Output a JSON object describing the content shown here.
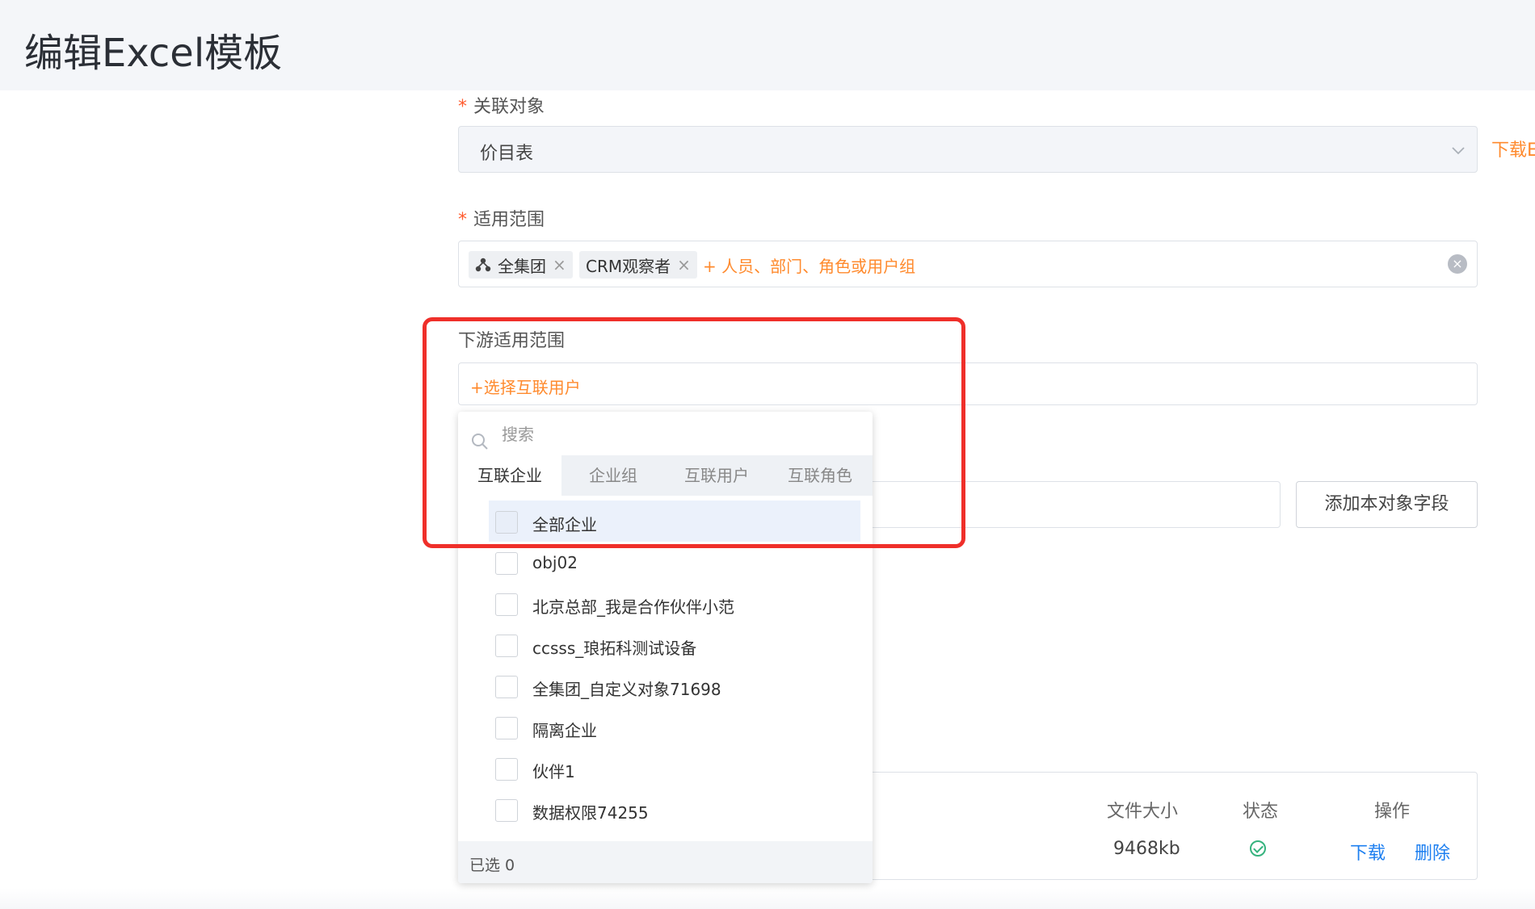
{
  "header": {
    "title": "编辑Excel模板"
  },
  "form": {
    "related_object": {
      "required_mark": "*",
      "label": "关联对象",
      "value": "价目表",
      "side_link": "下载E"
    },
    "scope": {
      "required_mark": "*",
      "label": "适用范围",
      "tags": [
        {
          "icon": "org-tree-icon",
          "label": "全集团"
        },
        {
          "label": "CRM观察者"
        }
      ],
      "tag_remove_glyph": "×",
      "add_label": "+ 人员、部门、角色或用户组",
      "clear_glyph": "×"
    },
    "downstream_scope": {
      "label": "下游适用范围",
      "add_label": "+选择互联用户"
    },
    "add_field_button": "添加本对象字段"
  },
  "picker": {
    "search_placeholder": "搜索",
    "tabs": [
      {
        "label": "互联企业",
        "active": true
      },
      {
        "label": "企业组",
        "active": false
      },
      {
        "label": "互联用户",
        "active": false
      },
      {
        "label": "互联角色",
        "active": false
      }
    ],
    "items": [
      {
        "label": "全部企业",
        "hover": true
      },
      {
        "label": "obj02"
      },
      {
        "label": "北京总部_我是合作伙伴小范"
      },
      {
        "label": "ccsss_琅拓科测试设备"
      },
      {
        "label": "全集团_自定义对象71698"
      },
      {
        "label": "隔离企业"
      },
      {
        "label": "伙伴1"
      },
      {
        "label": "数据权限74255"
      }
    ],
    "footer": "已选 0"
  },
  "file_table": {
    "headers": {
      "size": "文件大小",
      "status": "状态",
      "actions": "操作"
    },
    "row": {
      "size": "9468kb",
      "status": "success",
      "download": "下载",
      "delete": "删除"
    }
  },
  "colors": {
    "accent": "#ff8a2d",
    "link": "#1d7ff0",
    "highlight": "#ef2f2a",
    "success": "#36b37e"
  }
}
